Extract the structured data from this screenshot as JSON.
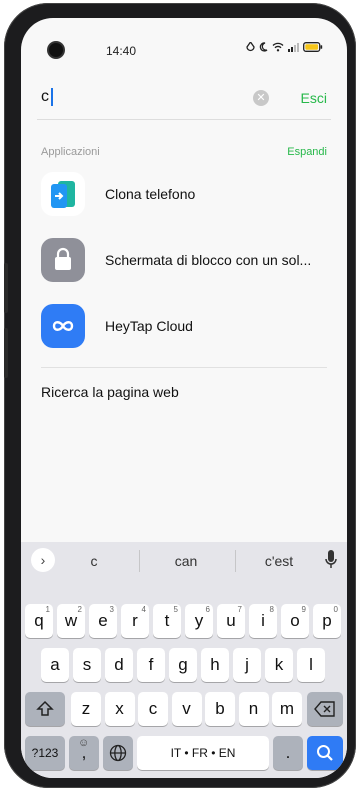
{
  "status": {
    "time": "14:40"
  },
  "search": {
    "query": "c",
    "cancel_label": "Esci",
    "clear_icon": "clear-icon"
  },
  "apps_section": {
    "title": "Applicazioni",
    "expand_label": "Espandi",
    "items": [
      {
        "label": "Clona telefono",
        "icon": "clone-phone-icon",
        "color": "#1aa3a3"
      },
      {
        "label": "Schermata di blocco con un sol...",
        "icon": "lock-bag-icon",
        "color": "#8f9099"
      },
      {
        "label": "HeyTap Cloud",
        "icon": "cloud-infinity-icon",
        "color": "#2f7cf5"
      }
    ]
  },
  "web_search": {
    "label": "Ricerca la pagina web"
  },
  "keyboard": {
    "suggestions": [
      "c",
      "can",
      "c'est"
    ],
    "row1": [
      {
        "k": "q",
        "n": "1"
      },
      {
        "k": "w",
        "n": "2"
      },
      {
        "k": "e",
        "n": "3"
      },
      {
        "k": "r",
        "n": "4"
      },
      {
        "k": "t",
        "n": "5"
      },
      {
        "k": "y",
        "n": "6"
      },
      {
        "k": "u",
        "n": "7"
      },
      {
        "k": "i",
        "n": "8"
      },
      {
        "k": "o",
        "n": "9"
      },
      {
        "k": "p",
        "n": "0"
      }
    ],
    "row2": [
      "a",
      "s",
      "d",
      "f",
      "g",
      "h",
      "j",
      "k",
      "l"
    ],
    "row3": [
      "z",
      "x",
      "c",
      "v",
      "b",
      "n",
      "m"
    ],
    "numbers_label": "?123",
    "comma_label": ",",
    "space_label": "IT • FR • EN",
    "period_label": "."
  },
  "colors": {
    "accent_green": "#27b84a",
    "search_key_blue": "#2f7bf5",
    "keyboard_bg": "#e5e5ea"
  }
}
